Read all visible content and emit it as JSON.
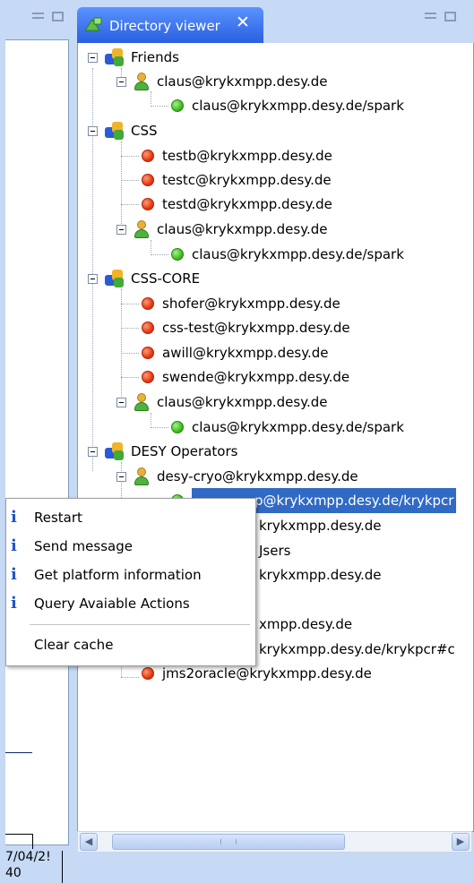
{
  "dir_view": {
    "tab_title": "Directory viewer",
    "close_glyph": "✕"
  },
  "left_view": {
    "fragment_1": "7/04/2!",
    "fragment_2": "40"
  },
  "tree": {
    "rows": [
      "Friends",
      "claus@krykxmpp.desy.de",
      "claus@krykxmpp.desy.de/spark",
      "CSS",
      "testb@krykxmpp.desy.de",
      "testc@krykxmpp.desy.de",
      "testd@krykxmpp.desy.de",
      "claus@krykxmpp.desy.de",
      "claus@krykxmpp.desy.de/spark",
      "CSS-CORE",
      "shofer@krykxmpp.desy.de",
      "css-test@krykxmpp.desy.de",
      "awill@krykxmpp.desy.de",
      "swende@krykxmpp.desy.de",
      "claus@krykxmpp.desy.de",
      "claus@krykxmpp.desy.de/spark",
      "DESY Operators",
      "desy-cryo@krykxmpp.desy.de",
      "p@krykxmpp.desy.de/krykpcr",
      "krykxmpp.desy.de",
      "Jsers",
      "krykxmpp.desy.de",
      "xmpp.desy.de",
      "krykxmpp.desy.de/krykpcr#c",
      "jms2oracle@krykxmpp.desy.de"
    ]
  },
  "context_menu": {
    "info_glyph": "i",
    "items": [
      "Restart",
      "Send message",
      "Get platform information",
      "Query Avaiable Actions",
      "Clear cache"
    ]
  },
  "scrollbar": {
    "left_arrow": "◀",
    "right_arrow": "▶"
  },
  "colors": {
    "background": "#c6d9f5",
    "tab": "#3b78ff",
    "selection": "#316ac5",
    "status_online": "#3fbd20",
    "status_offline": "#e43a12",
    "menu_info_icon": "#1f56c6"
  }
}
